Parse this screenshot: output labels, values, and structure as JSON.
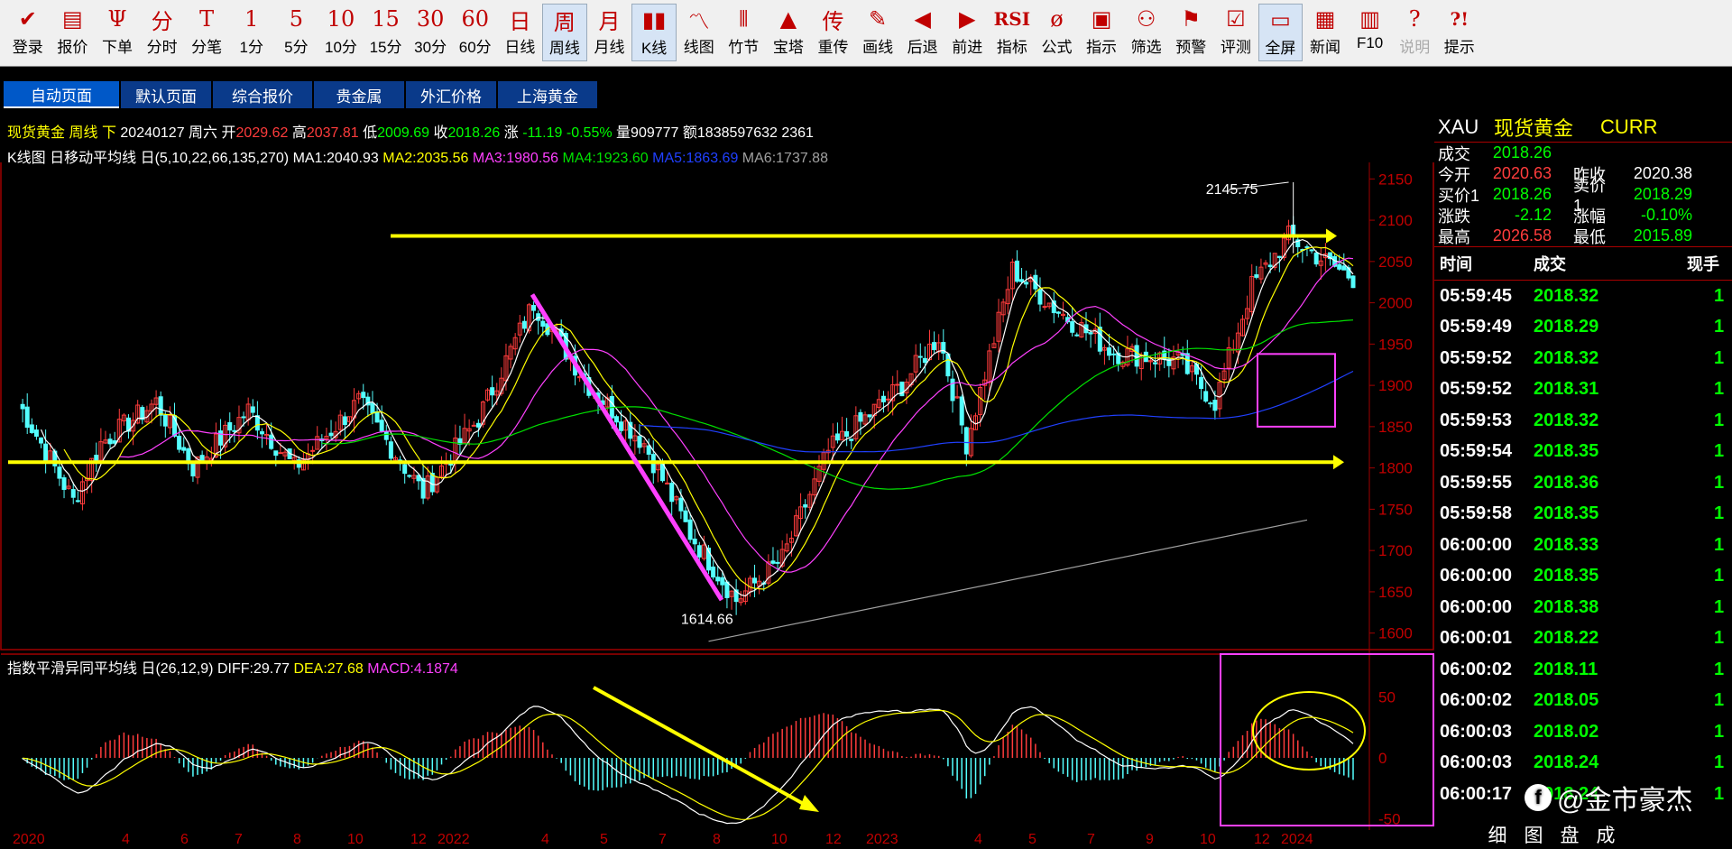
{
  "toolbar": [
    {
      "icon": "✔",
      "label": "登录",
      "name": "login"
    },
    {
      "icon": "▤",
      "label": "报价",
      "name": "quote"
    },
    {
      "icon": "Ψ",
      "label": "下单",
      "name": "order"
    },
    {
      "icon": "分",
      "label": "分时",
      "name": "timeshare"
    },
    {
      "icon": "T",
      "label": "分笔",
      "name": "tick"
    },
    {
      "icon": "1",
      "label": "1分",
      "name": "1min"
    },
    {
      "icon": "5",
      "label": "5分",
      "name": "5min"
    },
    {
      "icon": "10",
      "label": "10分",
      "name": "10min"
    },
    {
      "icon": "15",
      "label": "15分",
      "name": "15min"
    },
    {
      "icon": "30",
      "label": "30分",
      "name": "30min"
    },
    {
      "icon": "60",
      "label": "60分",
      "name": "60min"
    },
    {
      "icon": "日",
      "label": "日线",
      "name": "daily"
    },
    {
      "icon": "周",
      "label": "周线",
      "name": "weekly",
      "active": true
    },
    {
      "icon": "月",
      "label": "月线",
      "name": "monthly"
    },
    {
      "icon": "▮▮",
      "label": "K线",
      "name": "kline",
      "active": true
    },
    {
      "icon": "〽",
      "label": "线图",
      "name": "linechart"
    },
    {
      "icon": "⦀",
      "label": "竹节",
      "name": "bamboo"
    },
    {
      "icon": "▲",
      "label": "宝塔",
      "name": "tower"
    },
    {
      "icon": "传",
      "label": "重传",
      "name": "resend"
    },
    {
      "icon": "✎",
      "label": "画线",
      "name": "draw"
    },
    {
      "icon": "◀",
      "label": "后退",
      "name": "back"
    },
    {
      "icon": "▶",
      "label": "前进",
      "name": "forward"
    },
    {
      "icon": "RSI",
      "label": "指标",
      "name": "indicator"
    },
    {
      "icon": "ø",
      "label": "公式",
      "name": "formula"
    },
    {
      "icon": "▣",
      "label": "指示",
      "name": "indicate"
    },
    {
      "icon": "⚇",
      "label": "筛选",
      "name": "filter"
    },
    {
      "icon": "⚑",
      "label": "预警",
      "name": "alert"
    },
    {
      "icon": "☑",
      "label": "评测",
      "name": "evaluate"
    },
    {
      "icon": "▭",
      "label": "全屏",
      "name": "fullscreen",
      "active": true
    },
    {
      "icon": "▦",
      "label": "新闻",
      "name": "news"
    },
    {
      "icon": "▥",
      "label": "F10",
      "name": "f10"
    },
    {
      "icon": "?",
      "label": "说明",
      "name": "help-desc",
      "disabled": true
    },
    {
      "icon": "?!",
      "label": "提示",
      "name": "tips"
    }
  ],
  "tabs": [
    {
      "label": "自动页面",
      "active": true
    },
    {
      "label": "默认页面"
    },
    {
      "label": "综合报价"
    },
    {
      "label": "贵金属"
    },
    {
      "label": "外汇价格"
    },
    {
      "label": "上海黄金"
    }
  ],
  "header": {
    "symbol": "现货黄金",
    "period": "周线",
    "dir": "下",
    "date": "20240127",
    "weekday": "周六",
    "open_label": "开",
    "open": "2029.62",
    "high_label": "高",
    "high": "2037.81",
    "low_label": "低",
    "low": "2009.69",
    "close_label": "收",
    "close": "2018.26",
    "chg_label": "涨",
    "chg": "-11.19",
    "chg_pct": "-0.55%",
    "vol_label": "量",
    "vol": "909777",
    "amt_label": "额",
    "amt": "1838597632",
    "extra": "2361"
  },
  "ma": {
    "title": "K线图 日移动平均线 日(5,10,22,66,135,270)",
    "ma1": "MA1:2040.93",
    "ma2": "MA2:2035.56",
    "ma3": "MA3:1980.56",
    "ma4": "MA4:1923.60",
    "ma5": "MA5:1863.69",
    "ma6": "MA6:1737.88"
  },
  "macd": {
    "title": "指数平滑异同平均线 日(26,12,9)",
    "diff": "DIFF:29.77",
    "dea": "DEA:27.68",
    "macd": "MACD:4.1874"
  },
  "annotations": {
    "high": "2145.75",
    "low": "1614.66"
  },
  "colors": {
    "up": "#ff3c3c",
    "down": "#54ffff",
    "ma1": "#ffffff",
    "ma2": "#ffff00",
    "ma3": "#ff40ff",
    "ma4": "#00e000",
    "ma5": "#2040ff",
    "ma6": "#a0a0a0"
  },
  "chart_data": {
    "type": "candlestick",
    "price_ylim": [
      1580,
      2170
    ],
    "price_ticks": [
      "2150",
      "2100",
      "2050",
      "2000",
      "1950",
      "1900",
      "1850",
      "1800",
      "1750",
      "1700",
      "1650",
      "1600"
    ],
    "macd_ticks": [
      "50",
      "0",
      "-50"
    ],
    "x_ticks": [
      "2020",
      "4",
      "6",
      "7",
      "8",
      "10",
      "12",
      "2022",
      "4",
      "5",
      "7",
      "8",
      "10",
      "12",
      "2023",
      "4",
      "5",
      "7",
      "9",
      "10",
      "12",
      "2024"
    ]
  },
  "quote": {
    "code": "XAU",
    "name": "现货黄金",
    "type": "CURR",
    "rows": [
      [
        {
          "l": "成交",
          "v": "2018.26",
          "c": "#00ff00"
        }
      ],
      [
        {
          "l": "今开",
          "v": "2020.63",
          "c": "#ff3c3c"
        },
        {
          "l": "昨收",
          "v": "2020.38",
          "c": "#ffffff"
        }
      ],
      [
        {
          "l": "买价1",
          "v": "2018.26",
          "c": "#00ff00"
        },
        {
          "l": "卖价1",
          "v": "2018.29",
          "c": "#00ff00"
        }
      ],
      [
        {
          "l": "涨跌",
          "v": "-2.12",
          "c": "#00ff00"
        },
        {
          "l": "涨幅",
          "v": "-0.10%",
          "c": "#00ff00"
        }
      ],
      [
        {
          "l": "最高",
          "v": "2026.58",
          "c": "#ff3c3c"
        },
        {
          "l": "最低",
          "v": "2015.89",
          "c": "#00ff00"
        }
      ]
    ]
  },
  "ticks_head": {
    "time": "时间",
    "price": "成交",
    "vol": "现手"
  },
  "ticks": [
    {
      "t": "05:59:45",
      "p": "2018.32",
      "v": "1"
    },
    {
      "t": "05:59:49",
      "p": "2018.29",
      "v": "1"
    },
    {
      "t": "05:59:52",
      "p": "2018.32",
      "v": "1"
    },
    {
      "t": "05:59:52",
      "p": "2018.31",
      "v": "1"
    },
    {
      "t": "05:59:53",
      "p": "2018.32",
      "v": "1"
    },
    {
      "t": "05:59:54",
      "p": "2018.35",
      "v": "1"
    },
    {
      "t": "05:59:55",
      "p": "2018.36",
      "v": "1"
    },
    {
      "t": "05:59:58",
      "p": "2018.35",
      "v": "1"
    },
    {
      "t": "06:00:00",
      "p": "2018.33",
      "v": "1"
    },
    {
      "t": "06:00:00",
      "p": "2018.35",
      "v": "1"
    },
    {
      "t": "06:00:00",
      "p": "2018.38",
      "v": "1"
    },
    {
      "t": "06:00:01",
      "p": "2018.22",
      "v": "1"
    },
    {
      "t": "06:00:02",
      "p": "2018.11",
      "v": "1"
    },
    {
      "t": "06:00:02",
      "p": "2018.05",
      "v": "1"
    },
    {
      "t": "06:00:03",
      "p": "2018.02",
      "v": "1"
    },
    {
      "t": "06:00:03",
      "p": "2018.24",
      "v": "1"
    },
    {
      "t": "06:00:17",
      "p": "2018.24",
      "v": "1"
    }
  ],
  "bottom_tabs": [
    "细",
    "图",
    "盘",
    "成"
  ],
  "watermark": "@金市豪杰"
}
